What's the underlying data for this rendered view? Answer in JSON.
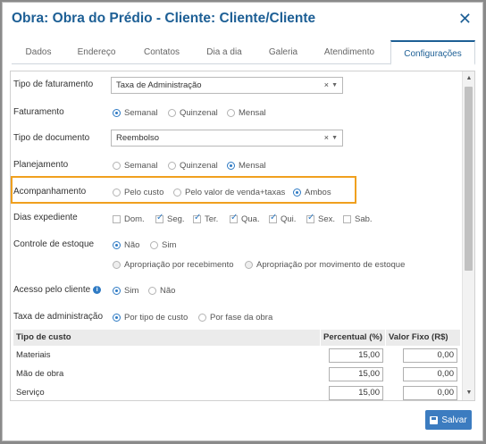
{
  "header": {
    "title": "Obra: Obra do Prédio - Cliente: Cliente/Cliente",
    "close": "✕"
  },
  "tabs": [
    {
      "label": "Dados"
    },
    {
      "label": "Endereço"
    },
    {
      "label": "Contatos"
    },
    {
      "label": "Dia a dia"
    },
    {
      "label": "Galeria"
    },
    {
      "label": "Atendimento"
    },
    {
      "label": "Configurações",
      "active": true
    }
  ],
  "form": {
    "tipo_faturamento": {
      "label": "Tipo de faturamento",
      "value": "Taxa de Administração"
    },
    "faturamento": {
      "label": "Faturamento",
      "options": [
        "Semanal",
        "Quinzenal",
        "Mensal"
      ],
      "selected": "Semanal"
    },
    "tipo_documento": {
      "label": "Tipo de documento",
      "value": "Reembolso"
    },
    "planejamento": {
      "label": "Planejamento",
      "options": [
        "Semanal",
        "Quinzenal",
        "Mensal"
      ],
      "selected": "Mensal"
    },
    "acompanhamento": {
      "label": "Acompanhamento",
      "options": [
        "Pelo custo",
        "Pelo valor de venda+taxas",
        "Ambos"
      ],
      "selected": "Ambos"
    },
    "dias_expediente": {
      "label": "Dias expediente",
      "days": [
        {
          "label": "Dom.",
          "checked": false
        },
        {
          "label": "Seg.",
          "checked": true
        },
        {
          "label": "Ter.",
          "checked": true
        },
        {
          "label": "Qua.",
          "checked": true
        },
        {
          "label": "Qui.",
          "checked": true
        },
        {
          "label": "Sex.",
          "checked": true
        },
        {
          "label": "Sab.",
          "checked": false
        }
      ]
    },
    "controle_estoque": {
      "label": "Controle de estoque",
      "options": [
        "Não",
        "Sim"
      ],
      "selected": "Não",
      "sub_options": [
        "Apropriação por recebimento",
        "Apropriação por movimento de estoque"
      ]
    },
    "acesso_cliente": {
      "label": "Acesso pelo cliente",
      "info_icon": "info-icon",
      "options": [
        "Sim",
        "Não"
      ],
      "selected": "Sim"
    },
    "taxa_administracao": {
      "label": "Taxa de administração",
      "options": [
        "Por tipo de custo",
        "Por fase da obra"
      ],
      "selected": "Por tipo de custo"
    }
  },
  "table": {
    "headers": [
      "Tipo de custo",
      "Percentual (%)",
      "Valor Fixo (R$)"
    ],
    "rows": [
      {
        "name": "Materiais",
        "percent": "15,00",
        "fixed": "0,00"
      },
      {
        "name": "Mão de obra",
        "percent": "15,00",
        "fixed": "0,00"
      },
      {
        "name": "Serviço",
        "percent": "15,00",
        "fixed": "0,00"
      }
    ]
  },
  "select_icons": {
    "clear": "×",
    "arrow": "▼"
  },
  "scrollbar": {
    "up": "▲",
    "down": "▼"
  },
  "footer": {
    "save_label": "Salvar",
    "save_icon": "floppy-disk-icon"
  },
  "colors": {
    "accent": "#1d5f95",
    "highlight": "#f0a01e",
    "button": "#3c7cc0"
  }
}
